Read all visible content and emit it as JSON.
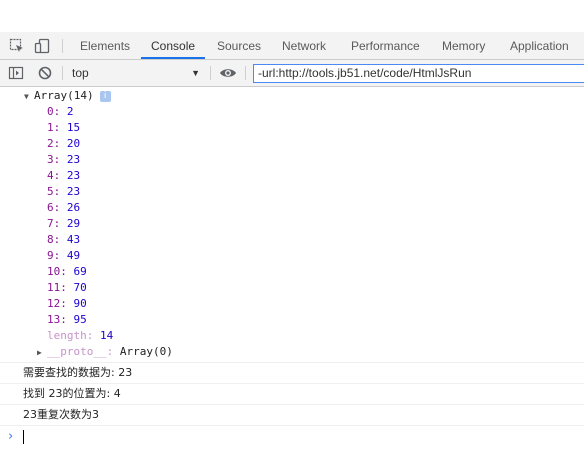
{
  "tabs": [
    {
      "label": "Elements"
    },
    {
      "label": "Console"
    },
    {
      "label": "Sources"
    },
    {
      "label": "Network"
    },
    {
      "label": "Performance"
    },
    {
      "label": "Memory"
    },
    {
      "label": "Application"
    }
  ],
  "active_tab": "Console",
  "toolbar": {
    "context": "top",
    "filter_value": "-url:http://tools.jb51.net/code/HtmlJsRun"
  },
  "array": {
    "header": "Array(14)",
    "info": "i",
    "items": [
      {
        "k": "0:",
        "v": "2"
      },
      {
        "k": "1:",
        "v": "15"
      },
      {
        "k": "2:",
        "v": "20"
      },
      {
        "k": "3:",
        "v": "23"
      },
      {
        "k": "4:",
        "v": "23"
      },
      {
        "k": "5:",
        "v": "23"
      },
      {
        "k": "6:",
        "v": "26"
      },
      {
        "k": "7:",
        "v": "29"
      },
      {
        "k": "8:",
        "v": "43"
      },
      {
        "k": "9:",
        "v": "49"
      },
      {
        "k": "10:",
        "v": "69"
      },
      {
        "k": "11:",
        "v": "70"
      },
      {
        "k": "12:",
        "v": "90"
      },
      {
        "k": "13:",
        "v": "95"
      }
    ],
    "length_key": "length:",
    "length_val": "14",
    "proto_key": "__proto__:",
    "proto_val": "Array(0)"
  },
  "messages": [
    "需要查找的数据为: 23",
    "找到 23的位置为:  4",
    "23重复次数为3"
  ],
  "colors": {
    "accent": "#1a73e8",
    "key": "#881391",
    "number": "#1c00cf",
    "prompt": "#367cf1"
  }
}
